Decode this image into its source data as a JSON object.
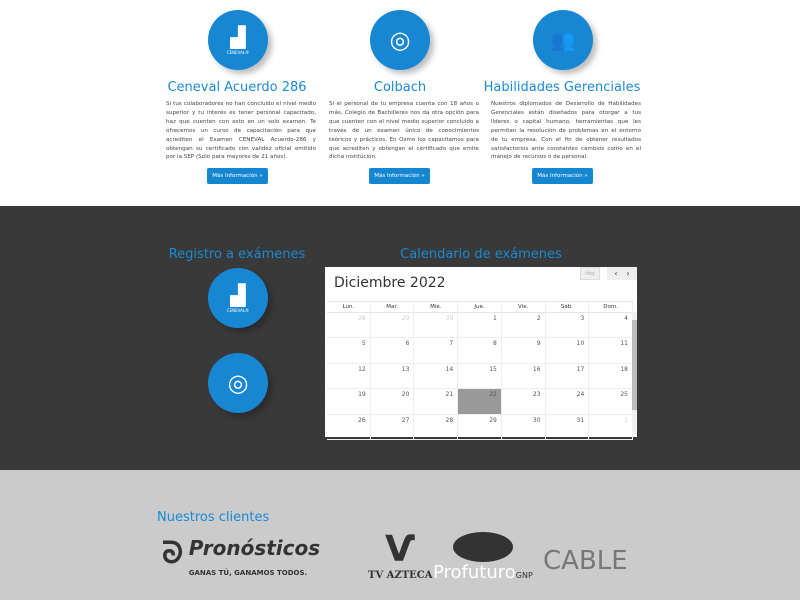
{
  "features": [
    {
      "title": "Ceneval Acuerdo 286",
      "icon": "ceneval-icon",
      "icon_label": "CENEVAL®",
      "text": "Si tus colaboradores no han concluido el nivel medio superior y tu interés es tener personal capacitado, haz que cuenten con esto en un solo examen. Te ofrecemos un curso de capacitación para que acrediten el Examen CENEVAL Acuerdo-286 y obtengan su certificado con validez oficial emitido por la SEP (Sólo para mayores de 21 años).",
      "button": "Más Información »"
    },
    {
      "title": "Colbach",
      "icon": "colbach-icon",
      "text": "Si el personal de tu empresa cuenta con 18 años o más, Colegio de Bachilleres nos da otra opción para que cuenten con el nivel medio superior concluido a través de un examen único de conocimientos teóricos y prácticos. En Osmo los capacitamos para que acrediten y obtengan el certificado que emite dicha institución.",
      "button": "Más Información »"
    },
    {
      "title": "Habilidades Gerenciales",
      "icon": "team-icon",
      "text": "Nuestros diplomados de Desarrollo de Habilidades Gerenciales están diseñados para otorgar a tus líderes o capital humano, herramientas que les permitan la resolución de problemas en el entorno de tu empresa. Con el fin de obtener resultados satisfactorios ante constantes cambios como en el manejo de recursos o de personal.",
      "button": "Más Información »"
    }
  ],
  "registro": {
    "title": "Registro a exámenes",
    "ceneval_label": "CENEVAL®"
  },
  "calendar": {
    "section_title": "Calendario de exámenes",
    "month": "Diciembre 2022",
    "today_button": "Hoy",
    "prev": "‹",
    "next": "›",
    "weekdays": [
      "Lun.",
      "Mar.",
      "Mié.",
      "Jue.",
      "Vie.",
      "Sáb.",
      "Dom."
    ],
    "weeks": [
      [
        "28",
        "29",
        "30",
        "1",
        "2",
        "3",
        "4"
      ],
      [
        "5",
        "6",
        "7",
        "8",
        "9",
        "10",
        "11"
      ],
      [
        "12",
        "13",
        "14",
        "15",
        "16",
        "17",
        "18"
      ],
      [
        "19",
        "20",
        "21",
        "22",
        "23",
        "24",
        "25"
      ],
      [
        "26",
        "27",
        "28",
        "29",
        "30",
        "31",
        "1"
      ]
    ],
    "highlighted": "22"
  },
  "clients": {
    "title": "Nuestros clientes",
    "logos": [
      {
        "name": "Pronósticos",
        "tagline": "GANAS TÚ, GANAMOS TODOS."
      },
      {
        "name": "TV AZTECA"
      },
      {
        "name": "Profuturo",
        "suffix": "GNP"
      },
      {
        "name": "CABLE"
      }
    ]
  },
  "colors": {
    "accent": "#1787d4",
    "dark": "#393939",
    "light": "#cbcbcb"
  }
}
